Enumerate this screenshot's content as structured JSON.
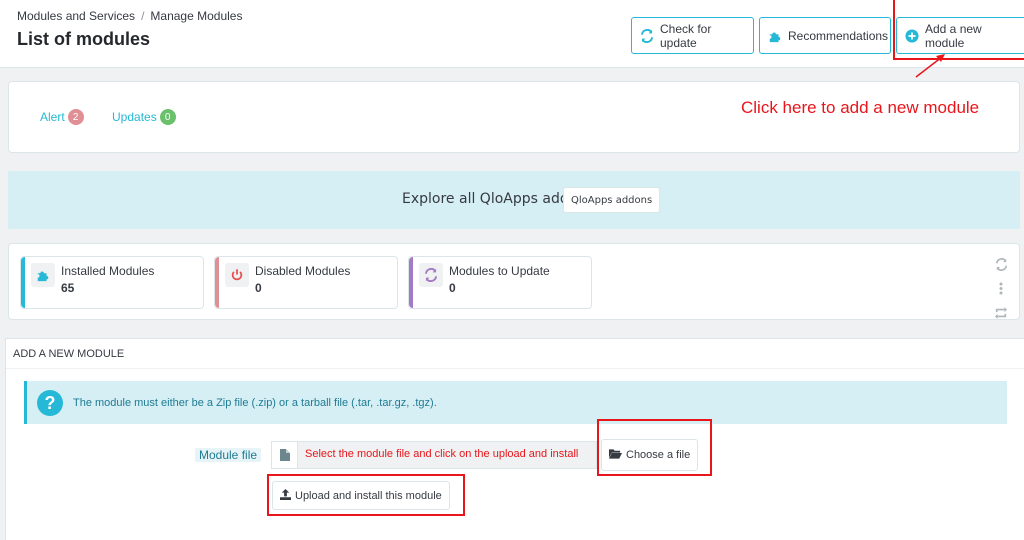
{
  "header": {
    "breadcrumb": [
      "Modules and Services",
      "Manage Modules"
    ],
    "title": "List of modules",
    "buttons": {
      "check_update": "Check for update",
      "recommendations": "Recommendations",
      "add_module": "Add a new module"
    }
  },
  "annotation": {
    "text": "Click here to add a new module",
    "color": "#e8161b"
  },
  "filters": {
    "alert_label": "Alert",
    "alert_count": "2",
    "updates_label": "Updates",
    "updates_count": "0"
  },
  "addons": {
    "text": "Explore all QloApps addons",
    "button": "QloApps addons"
  },
  "stats": [
    {
      "label": "Installed Modules",
      "value": "65",
      "color": "#25b9d7",
      "icon": "puzzle-icon"
    },
    {
      "label": "Disabled Modules",
      "value": "0",
      "color": "#e08f95",
      "icon": "power-icon"
    },
    {
      "label": "Modules to Update",
      "value": "0",
      "color": "#a37bc4",
      "icon": "refresh-icon"
    }
  ],
  "add_module": {
    "heading": "ADD A NEW MODULE",
    "info": "The module must either be a Zip file (.zip) or a tarball file (.tar, .tar.gz, .tgz).",
    "file_label": "Module file",
    "file_instruction": "Select the module file and click on the upload and install",
    "choose_button": "Choose a file",
    "upload_button": "Upload and install this module"
  },
  "colors": {
    "accent": "#25b9d7",
    "danger": "#e8161b",
    "info_bg": "#d5eff4"
  }
}
